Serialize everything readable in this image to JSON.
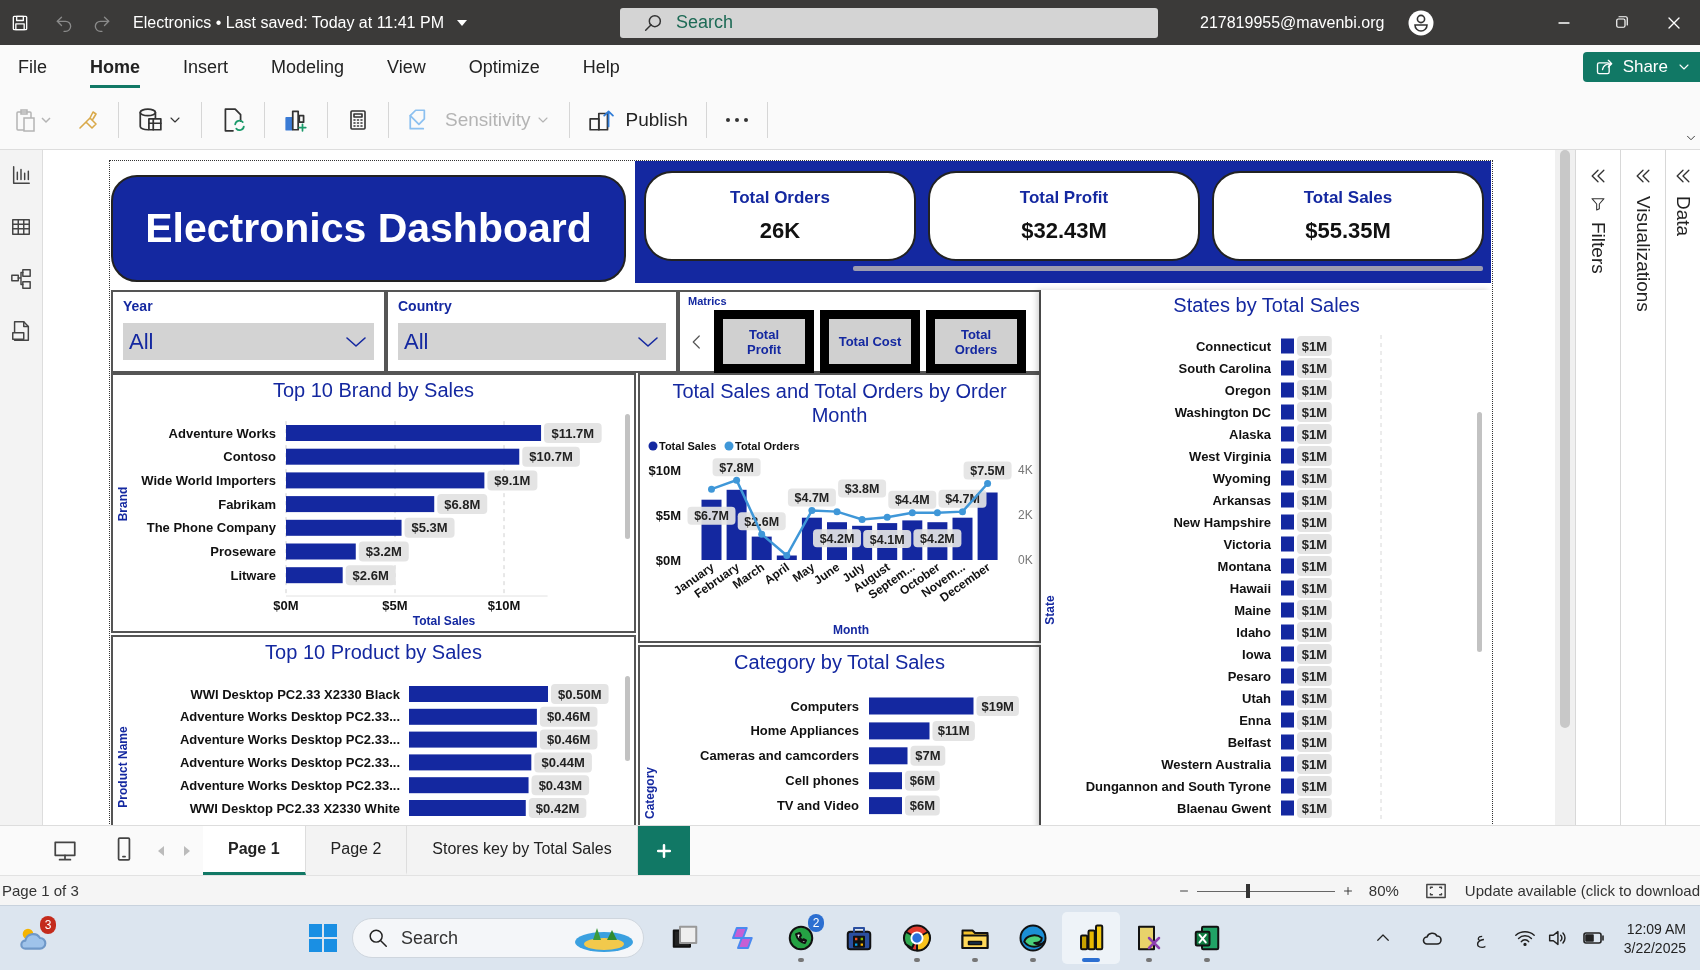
{
  "title_bar": {
    "undo": {
      "disabled": true
    },
    "redo": {
      "disabled": true
    },
    "title": "Electronics • Last saved: Today at 11:41 PM",
    "search": {
      "placeholder": "Search"
    },
    "account": "217819955@mavenbi.org"
  },
  "menu": {
    "tabs": [
      {
        "label": "File",
        "selected": false
      },
      {
        "label": "Home",
        "selected": true
      },
      {
        "label": "Insert",
        "selected": false
      },
      {
        "label": "Modeling",
        "selected": false
      },
      {
        "label": "View",
        "selected": false
      },
      {
        "label": "Optimize",
        "selected": false
      },
      {
        "label": "Help",
        "selected": false
      }
    ],
    "share": "Share"
  },
  "toolbar": {
    "paste": {
      "disabled": true
    },
    "sensitivity": {
      "label": "Sensitivity",
      "disabled": true
    },
    "publish": {
      "label": "Publish"
    }
  },
  "report": {
    "title": "Electronics Dashboard",
    "kpis": [
      {
        "label": "Total Orders",
        "value": "26K"
      },
      {
        "label": "Total Profit",
        "value": "$32.43M"
      },
      {
        "label": "Total Sales",
        "value": "$55.35M"
      }
    ],
    "slicers": [
      {
        "label": "Year",
        "value": "All"
      },
      {
        "label": "Country",
        "value": "All"
      }
    ],
    "metrics": {
      "title": "Matrics",
      "buttons": [
        "Total Profit",
        "Total Cost",
        "Total Orders"
      ]
    },
    "brand_chart": {
      "chart_data": {
        "type": "bar",
        "orientation": "horizontal",
        "title": "Top 10 Brand by Sales",
        "xlabel": "Total Sales",
        "ylabel": "Brand",
        "categories": [
          "Adventure Works",
          "Contoso",
          "Wide World Importers",
          "Fabrikam",
          "The Phone Company",
          "Proseware",
          "Litware"
        ],
        "values": [
          11.7,
          10.7,
          9.1,
          6.8,
          5.3,
          3.2,
          2.6
        ],
        "xlim": [
          0,
          12
        ],
        "xticks": [
          {
            "value": 0,
            "label": "$0M"
          },
          {
            "value": 5,
            "label": "$5M"
          },
          {
            "value": 10,
            "label": "$10M"
          }
        ],
        "value_labels": [
          "$11.7M",
          "$10.7M",
          "$9.1M",
          "$6.8M",
          "$5.3M",
          "$3.2M",
          "$2.6M"
        ]
      }
    },
    "month_chart": {
      "chart_data": {
        "type": "bar",
        "title": "Total Sales and Total Orders by Order Month",
        "xlabel": "Month",
        "legend": "top-left",
        "categories": [
          "January",
          "February",
          "March",
          "April",
          "May",
          "June",
          "July",
          "August",
          "Septem...",
          "October",
          "Novem...",
          "December"
        ],
        "series": [
          {
            "name": "Total Sales",
            "color": "#1428a0",
            "type": "bar",
            "values": [
              6.7,
              7.8,
              2.6,
              0.5,
              4.7,
              4.2,
              3.8,
              4.1,
              4.4,
              4.2,
              4.7,
              7.5
            ]
          },
          {
            "name": "Total Orders",
            "color": "#3f97d8",
            "type": "line",
            "axis": "y2",
            "marker": "circle",
            "values": [
              3150,
              3550,
              1150,
              200,
              2200,
              2150,
              1800,
              1900,
              2100,
              2100,
              2150,
              3400
            ]
          }
        ],
        "ylim": [
          0,
          10
        ],
        "yticks": [
          {
            "value": 0,
            "label": "$0M"
          },
          {
            "value": 5,
            "label": "$5M"
          },
          {
            "value": 10,
            "label": "$10M"
          }
        ],
        "y2lim": [
          0,
          4000
        ],
        "y2ticks": [
          {
            "value": 0,
            "label": "0K"
          },
          {
            "value": 2000,
            "label": "2K"
          },
          {
            "value": 4000,
            "label": "4K"
          }
        ],
        "value_labels": [
          "$6.7M",
          "$7.8M",
          "$2.6M",
          null,
          "$4.7M",
          "$4.2M",
          "$3.8M",
          "$4.1M",
          "$4.4M",
          "$4.2M",
          "$4.7M",
          "$7.5M"
        ]
      }
    },
    "product_chart": {
      "chart_data": {
        "type": "bar",
        "orientation": "horizontal",
        "title": "Top 10 Product by Sales",
        "ylabel": "Product Name",
        "categories": [
          "WWI Desktop PC2.33 X2330 Black",
          "Adventure Works Desktop PC2.33...",
          "Adventure Works Desktop PC2.33...",
          "Adventure Works Desktop PC2.33...",
          "Adventure Works Desktop PC2.33...",
          "WWI Desktop PC2.33 X2330 White"
        ],
        "values": [
          0.5,
          0.46,
          0.46,
          0.44,
          0.43,
          0.42
        ],
        "value_labels": [
          "$0.50M",
          "$0.46M",
          "$0.46M",
          "$0.44M",
          "$0.43M",
          "$0.42M"
        ]
      }
    },
    "category_chart": {
      "chart_data": {
        "type": "bar",
        "orientation": "horizontal",
        "title": "Category by Total Sales",
        "ylabel": "Category",
        "categories": [
          "Computers",
          "Home Appliances",
          "Cameras and camcorders",
          "Cell phones",
          "TV and Video"
        ],
        "values": [
          19,
          11,
          7,
          6,
          6
        ],
        "value_labels": [
          "$19M",
          "$11M",
          "$7M",
          "$6M",
          "$6M"
        ]
      }
    },
    "state_chart": {
      "chart_data": {
        "type": "bar",
        "orientation": "horizontal",
        "title": "States by Total Sales",
        "ylabel": "State",
        "categories": [
          "Connecticut",
          "South Carolina",
          "Oregon",
          "Washington DC",
          "Alaska",
          "West Virginia",
          "Wyoming",
          "Arkansas",
          "New Hampshire",
          "Victoria",
          "Montana",
          "Hawaii",
          "Maine",
          "Idaho",
          "Iowa",
          "Pesaro",
          "Utah",
          "Enna",
          "Belfast",
          "Western Australia",
          "Dungannon and South Tyrone",
          "Blaenau Gwent"
        ],
        "values": [
          1,
          1,
          1,
          1,
          1,
          1,
          1,
          1,
          1,
          1,
          1,
          1,
          1,
          1,
          1,
          1,
          1,
          1,
          1,
          1,
          1,
          1
        ],
        "value_labels": [
          "$1M",
          "$1M",
          "$1M",
          "$1M",
          "$1M",
          "$1M",
          "$1M",
          "$1M",
          "$1M",
          "$1M",
          "$1M",
          "$1M",
          "$1M",
          "$1M",
          "$1M",
          "$1M",
          "$1M",
          "$1M",
          "$1M",
          "$1M",
          "$1M",
          "$1M"
        ]
      }
    }
  },
  "panes": [
    {
      "label": "Filters"
    },
    {
      "label": "Visualizations"
    },
    {
      "label": "Data"
    }
  ],
  "page_tabs": [
    {
      "label": "Page 1",
      "selected": true
    },
    {
      "label": "Page 2",
      "selected": false
    },
    {
      "label": "Stores key by Total Sales",
      "selected": false
    }
  ],
  "status_bar": {
    "page": "Page 1 of 3",
    "zoom": {
      "level": 0.37,
      "reading": "80%"
    },
    "update": "Update available (click to download"
  },
  "taskbar": {
    "widget_badge": "3",
    "search": {
      "placeholder": "Search"
    },
    "apps": [
      {
        "running": false,
        "selected": false
      },
      {
        "running": false,
        "selected": false
      },
      {
        "running": true,
        "selected": false,
        "badge": "2"
      },
      {
        "running": false,
        "selected": false
      },
      {
        "running": true,
        "selected": false
      },
      {
        "running": true,
        "selected": false
      },
      {
        "running": true,
        "selected": false
      },
      {
        "running": true,
        "selected": true
      },
      {
        "running": true,
        "selected": false
      },
      {
        "running": true,
        "selected": false
      }
    ],
    "tray": {
      "language": "ع",
      "time": "12:09 AM",
      "date": "3/22/2025"
    }
  }
}
